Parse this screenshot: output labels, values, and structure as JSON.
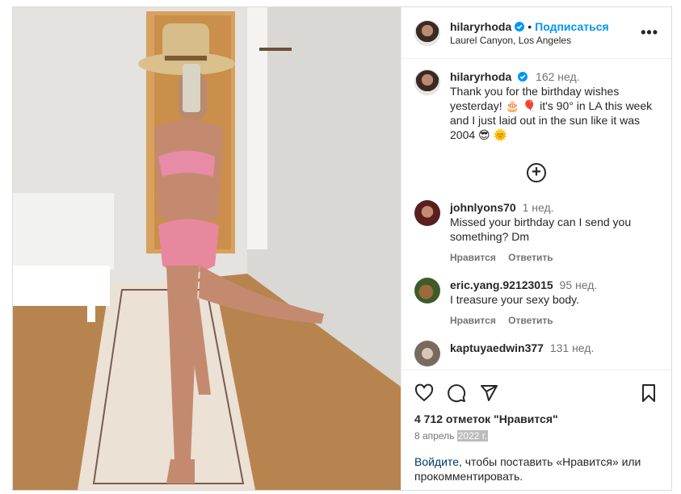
{
  "post": {
    "username": "hilaryrhoda",
    "follow_label": "Подписаться",
    "location": "Laurel Canyon, Los Angeles",
    "more_label": "•••"
  },
  "caption": {
    "username": "hilaryrhoda",
    "time": "162 нед.",
    "text": "Thank you for the birthday wishes yesterday! 🎂 🎈 it's 90° in LA this week and I just laid out in the sun like it was 2004 😎 🌞"
  },
  "load_more_label": "+",
  "comments": [
    {
      "username": "johnlyons70",
      "time": "1 нед.",
      "text": "Missed your birthday can I send you something? Dm",
      "like_label": "Нравится",
      "reply_label": "Ответить"
    },
    {
      "username": "eric.yang.92123015",
      "time": "95 нед.",
      "text": "I treasure your sexy body.",
      "like_label": "Нравится",
      "reply_label": "Ответить"
    },
    {
      "username": "kaptuyaedwin377",
      "time": "131 нед."
    }
  ],
  "actions": {
    "likes": "4 712 отметок \"Нравится\"",
    "date_prefix": "8 апрель",
    "date_year": "2022 г."
  },
  "login_prompt": {
    "link": "Войдите",
    "rest": ", чтобы поставить «Нравится» или прокомментировать."
  },
  "colors": {
    "accent": "#0095f6",
    "link": "#00376b",
    "muted": "#737373",
    "border": "#dbdbdb"
  }
}
